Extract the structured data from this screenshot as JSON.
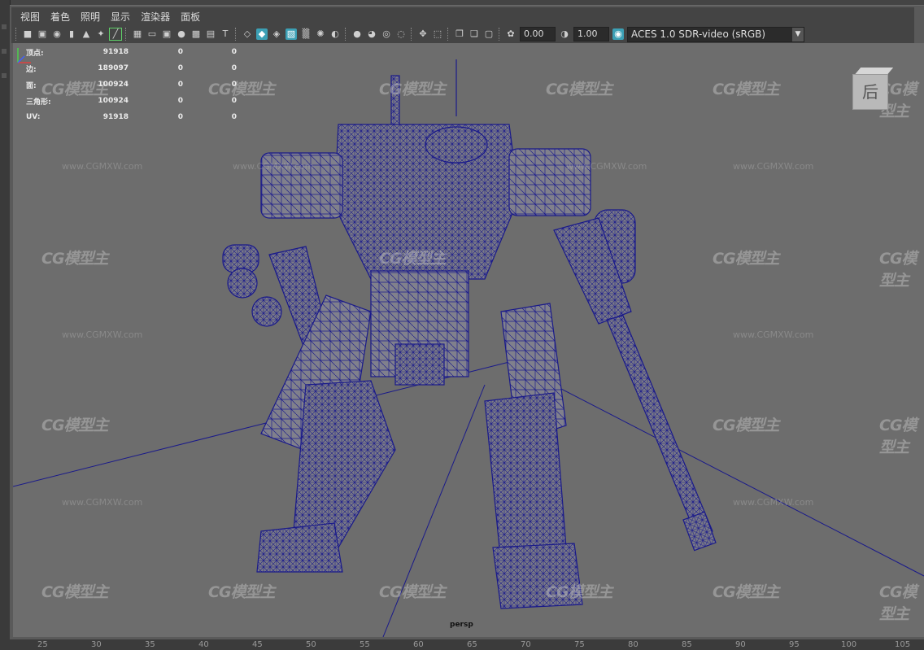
{
  "menu": [
    "视图",
    "着色",
    "照明",
    "显示",
    "渲染器",
    "面板"
  ],
  "toolbar": {
    "icons": [
      "camera-icon",
      "camera-lock-icon",
      "camera-attributes-icon",
      "bookmark-icon",
      "image-plane-icon",
      "grease-pencil-icon",
      "grid-icon",
      "film-gate-icon",
      "resolution-gate-icon",
      "gate-mask-icon",
      "field-chart-icon",
      "safe-action-icon",
      "safe-title-icon",
      "wireframe-icon",
      "smooth-shade-icon",
      "wireframe-on-shaded-icon",
      "textured-icon",
      "use-lights-icon",
      "shadows-icon",
      "screen-space-ao-icon",
      "motion-blur-icon",
      "anti-alias-icon",
      "depth-of-field-icon",
      "isolate-select-icon",
      "xray-icon",
      "xray-joints-icon",
      "backface-icon",
      "exposure-icon",
      "gamma-icon",
      "color-management-icon"
    ],
    "exposure_value": "0.00",
    "gamma_value": "1.00",
    "color_space": "ACES 1.0 SDR-video (sRGB)"
  },
  "stats": [
    {
      "label": "顶点:",
      "v1": "91918",
      "v2": "0",
      "v3": "0"
    },
    {
      "label": "边:",
      "v1": "189097",
      "v2": "0",
      "v3": "0"
    },
    {
      "label": "面:",
      "v1": "100924",
      "v2": "0",
      "v3": "0"
    },
    {
      "label": "三角形:",
      "v1": "100924",
      "v2": "0",
      "v3": "0"
    },
    {
      "label": "UV:",
      "v1": "91918",
      "v2": "0",
      "v3": "0"
    }
  ],
  "view_cube_label": "后",
  "camera_label": "persp",
  "watermark": {
    "logo": "CG模型主",
    "url": "www.CGMXW.com"
  },
  "ruler": [
    "25",
    "30",
    "35",
    "40",
    "45",
    "50",
    "55",
    "60",
    "65",
    "70",
    "75",
    "80",
    "85",
    "90",
    "95",
    "100",
    "105"
  ],
  "colors": {
    "wireframe": "#1a1a8a",
    "active_icon": "#3ca0b5",
    "viewport_bg": "#6d6d6d"
  }
}
